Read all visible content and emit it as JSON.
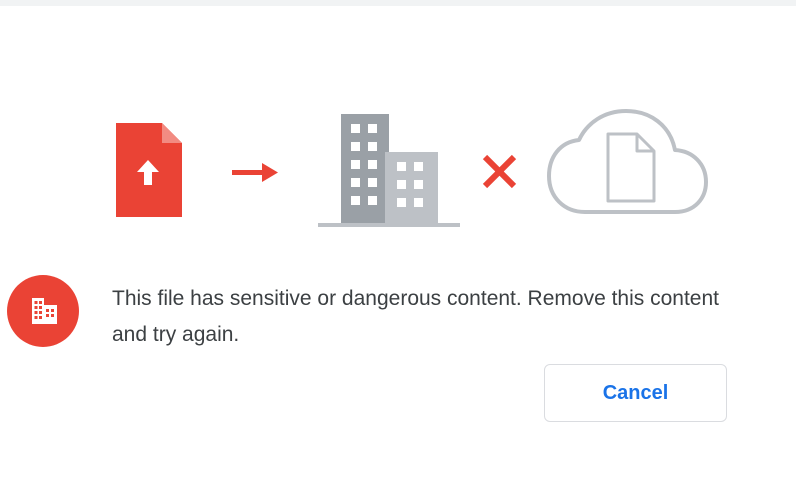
{
  "dialog": {
    "message": "This file has sensitive or dangerous content. Remove this content and try again.",
    "cancel_label": "Cancel"
  },
  "illustration": {
    "icons": [
      "file-upload-icon",
      "arrow-right-icon",
      "organization-building-icon",
      "blocked-x-icon",
      "cloud-file-icon"
    ]
  },
  "alert_icon": "organization-building-icon",
  "colors": {
    "danger": "#ea4335",
    "primary": "#1a73e8",
    "text": "#3c4043",
    "building_dark": "#9aa0a6",
    "building_light": "#bdc1c6",
    "cloud_outline": "#bdc1c6",
    "button_border": "#dadce0"
  }
}
